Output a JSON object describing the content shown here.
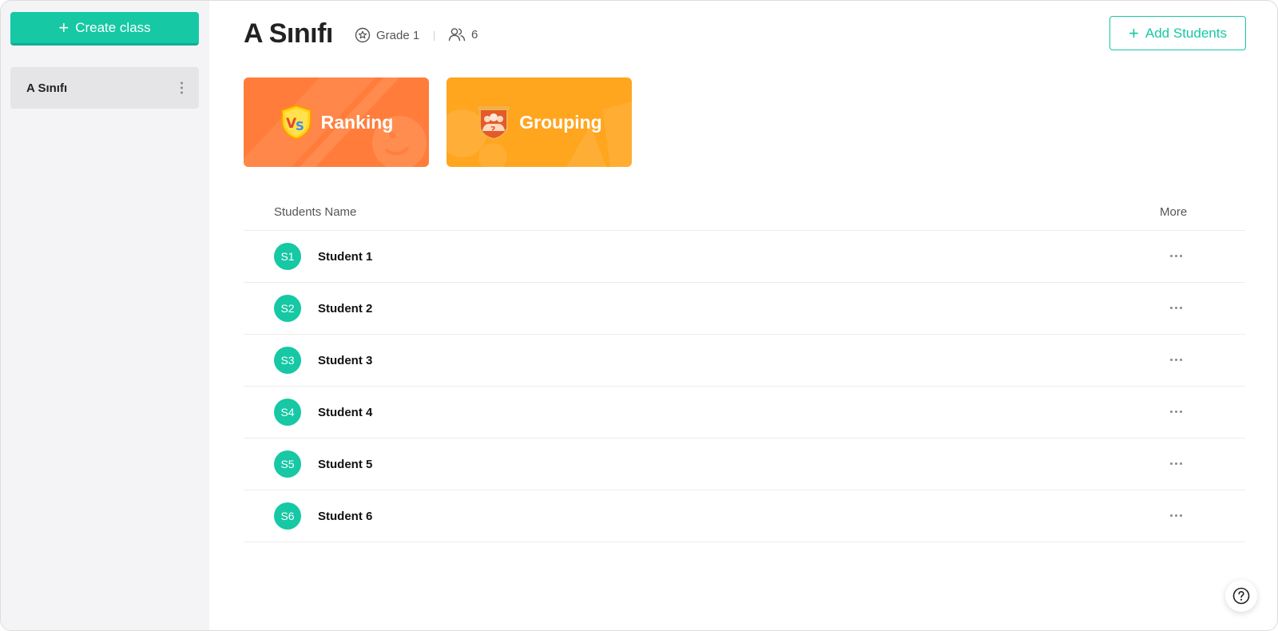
{
  "sidebar": {
    "create_label": "Create class",
    "classes": [
      {
        "label": "A Sınıfı"
      }
    ]
  },
  "header": {
    "title": "A Sınıfı",
    "grade": "Grade 1",
    "student_count": "6",
    "add_label": "Add Students"
  },
  "cards": {
    "ranking": {
      "label": "Ranking",
      "color": "#ff7c3b"
    },
    "grouping": {
      "label": "Grouping",
      "color": "#ffa51e"
    }
  },
  "table": {
    "columns": {
      "name": "Students Name",
      "more": "More"
    },
    "rows": [
      {
        "initials": "S1",
        "name": "Student 1"
      },
      {
        "initials": "S2",
        "name": "Student 2"
      },
      {
        "initials": "S3",
        "name": "Student 3"
      },
      {
        "initials": "S4",
        "name": "Student 4"
      },
      {
        "initials": "S5",
        "name": "Student 5"
      },
      {
        "initials": "S6",
        "name": "Student 6"
      }
    ]
  },
  "theme": {
    "accent": "#16c8a4"
  },
  "icons": {
    "grade": "star-circle-icon",
    "students": "users-icon",
    "more": "ellipsis-icon",
    "help": "question-circle-icon"
  }
}
